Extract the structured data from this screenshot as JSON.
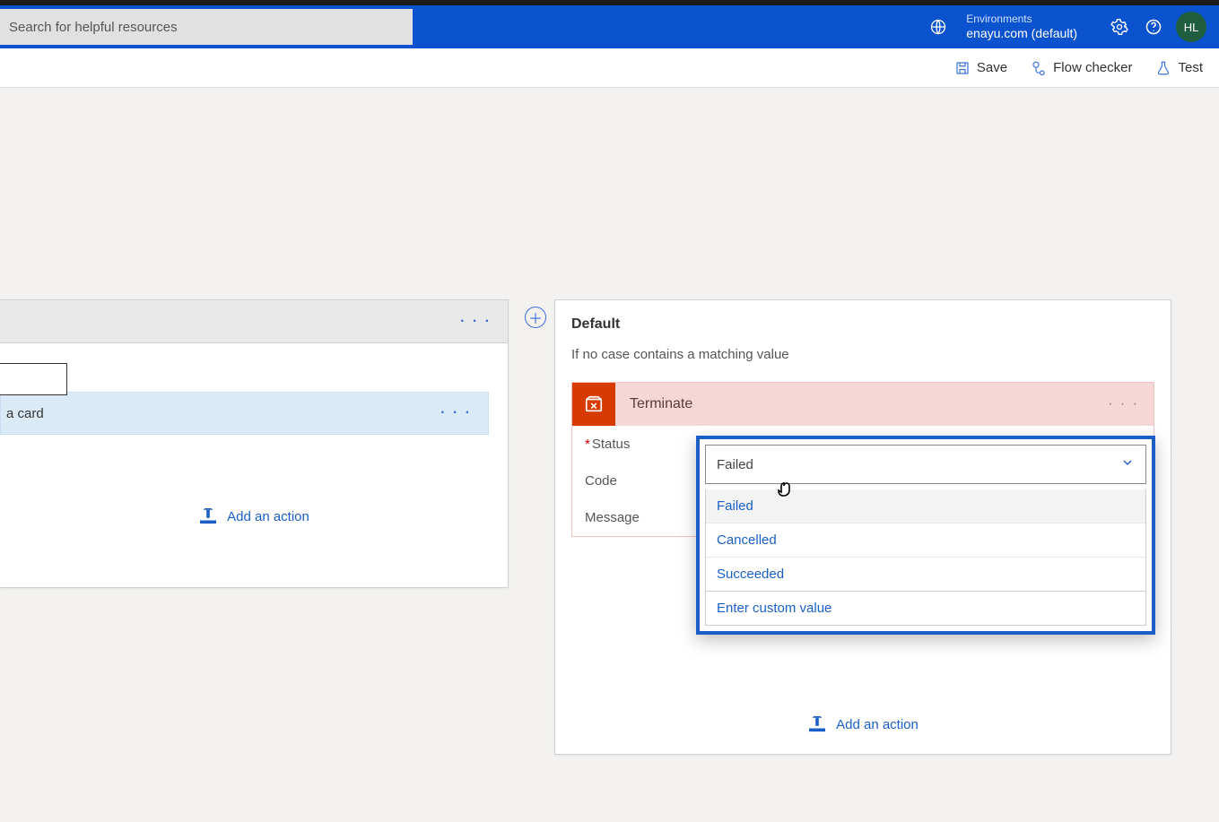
{
  "header": {
    "search_placeholder": "Search for helpful resources",
    "env_label": "Environments",
    "env_name": "enayu.com (default)",
    "avatar": "HL"
  },
  "toolbar": {
    "save": "Save",
    "flowchecker": "Flow checker",
    "test": "Test"
  },
  "left": {
    "card_fragment": "a card",
    "add_action": "Add an action"
  },
  "right": {
    "title": "Default",
    "desc": "If no case contains a matching value",
    "terminate": "Terminate",
    "fields": {
      "status_label": "Status",
      "code_label": "Code",
      "message_label": "Message"
    },
    "add_action": "Add an action"
  },
  "dropdown": {
    "selected": "Failed",
    "options": [
      "Failed",
      "Cancelled",
      "Succeeded"
    ],
    "custom": "Enter custom value"
  }
}
